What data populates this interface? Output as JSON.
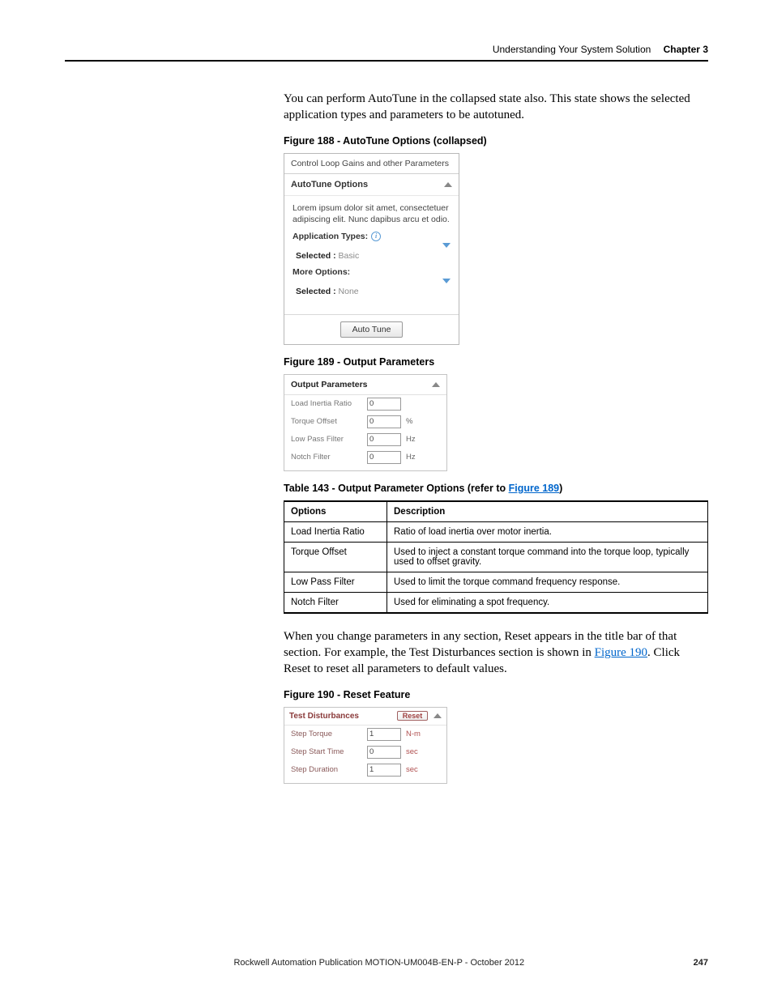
{
  "header": {
    "section": "Understanding Your System Solution",
    "chapter": "Chapter 3"
  },
  "p1": "You can perform AutoTune in the collapsed state also. This state shows the selected application types and parameters to be autotuned.",
  "fig188": {
    "caption": "Figure 188 - AutoTune Options (collapsed)",
    "top": "Control Loop Gains and other Parameters",
    "title": "AutoTune Options",
    "desc": "Lorem ipsum dolor sit amet, consectetuer adipiscing elit. Nunc dapibus arcu et odio.",
    "appTypesLabel": "Application Types:",
    "selected1_label": "Selected :",
    "selected1_value": "Basic",
    "moreLabel": "More Options:",
    "selected2_label": "Selected :",
    "selected2_value": "None",
    "button": "Auto Tune"
  },
  "fig189": {
    "caption": "Figure 189 - Output Parameters",
    "title": "Output Parameters",
    "rows": [
      {
        "label": "Load Inertia Ratio",
        "value": "0",
        "unit": ""
      },
      {
        "label": "Torque Offset",
        "value": "0",
        "unit": "%"
      },
      {
        "label": "Low Pass Filter",
        "value": "0",
        "unit": "Hz"
      },
      {
        "label": "Notch Filter",
        "value": "0",
        "unit": "Hz"
      }
    ]
  },
  "table143": {
    "caption_pre": "Table 143 - Output Parameter Options (refer to ",
    "caption_link": "Figure 189",
    "caption_post": ")",
    "head": {
      "c1": "Options",
      "c2": "Description"
    },
    "rows": [
      {
        "opt": "Load Inertia Ratio",
        "desc": "Ratio of load inertia over motor inertia."
      },
      {
        "opt": "Torque Offset",
        "desc": "Used to inject a constant torque command into the torque loop, typically used to offset gravity."
      },
      {
        "opt": "Low Pass Filter",
        "desc": "Used to limit the torque command frequency response."
      },
      {
        "opt": "Notch Filter",
        "desc": "Used for eliminating a spot frequency."
      }
    ]
  },
  "p2_pre": "When you change parameters in any section, Reset appears in the title bar of that section. For example, the Test Disturbances section is shown in ",
  "p2_link": "Figure 190",
  "p2_post": ". Click Reset to reset all parameters to default values.",
  "fig190": {
    "caption": "Figure 190 - Reset Feature",
    "title": "Test Disturbances",
    "reset": "Reset",
    "rows": [
      {
        "label": "Step Torque",
        "value": "1",
        "unit": "N-m"
      },
      {
        "label": "Step Start Time",
        "value": "0",
        "unit": "sec"
      },
      {
        "label": "Step Duration",
        "value": "1",
        "unit": "sec"
      }
    ]
  },
  "footer": {
    "pub": "Rockwell Automation Publication MOTION-UM004B-EN-P - October 2012",
    "page": "247"
  }
}
